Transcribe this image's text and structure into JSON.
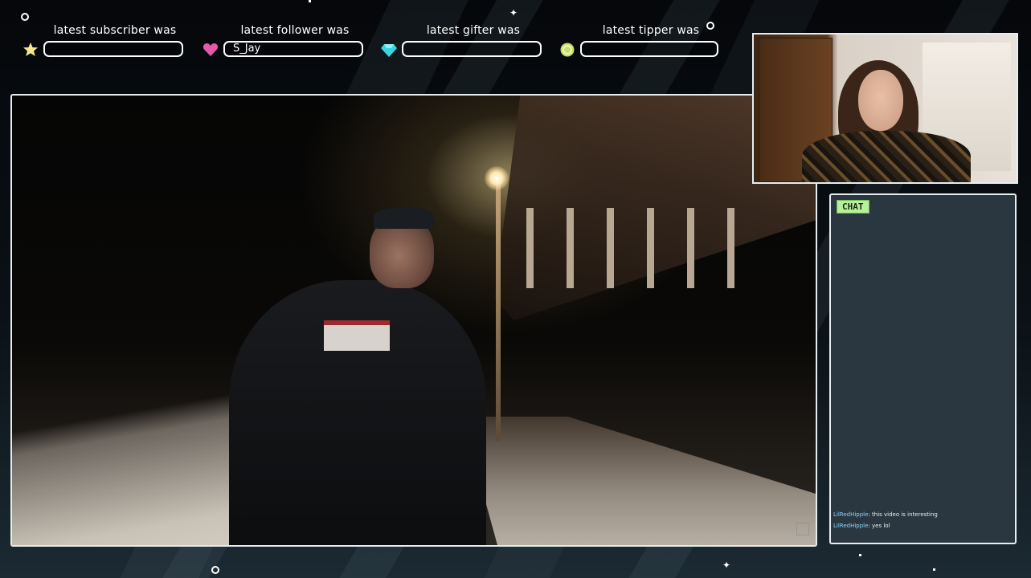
{
  "alerts": [
    {
      "title": "latest subscriber was",
      "value": "",
      "icon": "star-icon",
      "icon_color": "#f3e98a"
    },
    {
      "title": "latest follower was",
      "value": "S_Jay",
      "icon": "heart-icon",
      "icon_color": "#e45aa8"
    },
    {
      "title": "latest gifter was",
      "value": "",
      "icon": "gem-icon",
      "icon_color": "#39d6e0"
    },
    {
      "title": "latest tipper was",
      "value": "",
      "icon": "coin-icon",
      "icon_color": "#c8e06a"
    }
  ],
  "chat": {
    "label": "CHAT",
    "messages": [
      {
        "user": "LilRedHipple",
        "text": ": this video is interesting"
      },
      {
        "user": "LilRedHipple",
        "text": ": yes lol"
      }
    ]
  },
  "colors": {
    "frame_border": "#e6edf0",
    "chat_bg": "#2a3740",
    "chat_label_bg": "#b7ef9a"
  }
}
